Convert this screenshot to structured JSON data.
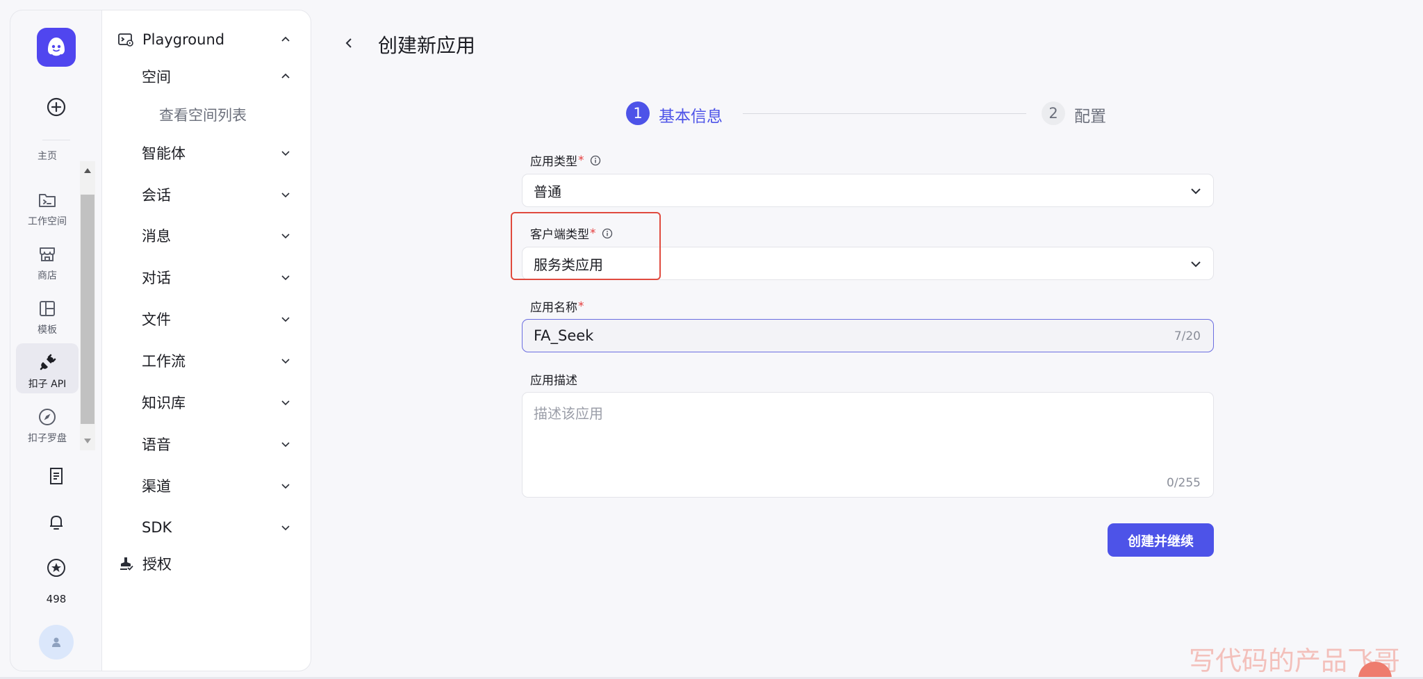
{
  "rail": {
    "items": [
      {
        "label": "主页",
        "icon": "home-icon"
      },
      {
        "label": "工作空间",
        "icon": "terminal-folder-icon"
      },
      {
        "label": "商店",
        "icon": "store-icon"
      },
      {
        "label": "模板",
        "icon": "template-icon"
      },
      {
        "label": "扣子 API",
        "icon": "plug-icon",
        "active": true
      },
      {
        "label": "扣子罗盘",
        "icon": "compass-icon"
      }
    ],
    "credits": "498"
  },
  "sidebar": {
    "items": [
      {
        "label": "Playground",
        "level": 0,
        "chevron": "up"
      },
      {
        "label": "空间",
        "level": 1,
        "chevron": "up"
      },
      {
        "label": "查看空间列表",
        "level": 2
      },
      {
        "label": "智能体",
        "level": 1,
        "chevron": "down"
      },
      {
        "label": "会话",
        "level": 1,
        "chevron": "down"
      },
      {
        "label": "消息",
        "level": 1,
        "chevron": "down"
      },
      {
        "label": "对话",
        "level": 1,
        "chevron": "down"
      },
      {
        "label": "文件",
        "level": 1,
        "chevron": "down"
      },
      {
        "label": "工作流",
        "level": 1,
        "chevron": "down"
      },
      {
        "label": "知识库",
        "level": 1,
        "chevron": "down"
      },
      {
        "label": "语音",
        "level": 1,
        "chevron": "down"
      },
      {
        "label": "渠道",
        "level": 1,
        "chevron": "down"
      },
      {
        "label": "SDK",
        "level": 1,
        "chevron": "down"
      },
      {
        "label": "授权",
        "level": 0
      }
    ]
  },
  "page": {
    "title": "创建新应用"
  },
  "steps": [
    {
      "number": "1",
      "label": "基本信息"
    },
    {
      "number": "2",
      "label": "配置"
    }
  ],
  "form": {
    "app_type": {
      "label": "应用类型",
      "required": "*",
      "value": "普通"
    },
    "client_type": {
      "label": "客户端类型",
      "required": "*",
      "value": "服务类应用"
    },
    "app_name": {
      "label": "应用名称",
      "required": "*",
      "value": "FA_Seek",
      "count": "7/20"
    },
    "app_desc": {
      "label": "应用描述",
      "placeholder": "描述该应用",
      "count": "0/255"
    },
    "submit_label": "创建并继续"
  },
  "watermark": "写代码的产品飞哥",
  "colors": {
    "primary": "#4d53e8",
    "highlight_border": "#e04a3e",
    "required": "#e53e3e"
  }
}
